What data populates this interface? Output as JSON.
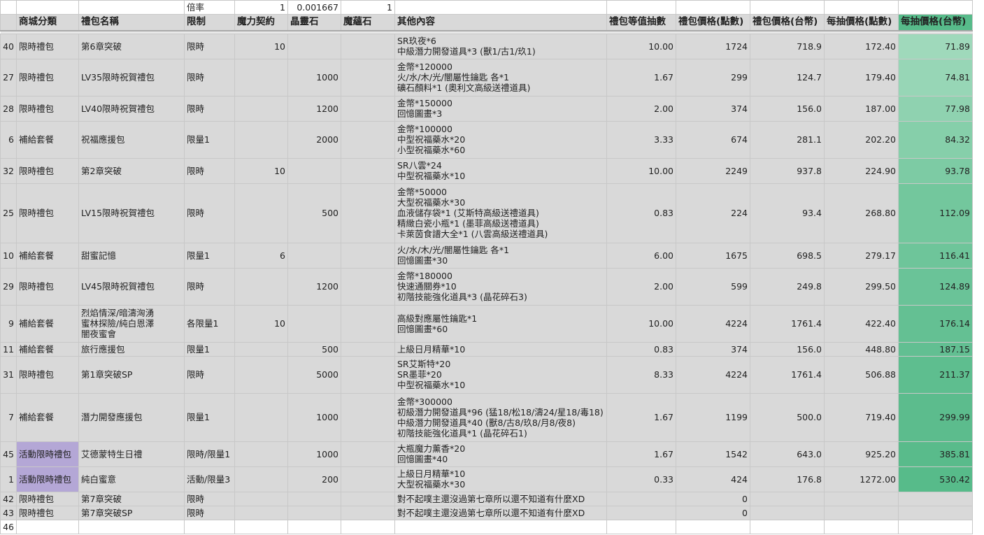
{
  "top_row": {
    "label": "倍率",
    "v1": "1",
    "v2": "0.001667",
    "v3": "1"
  },
  "headers": [
    "商城分類",
    "禮包名稱",
    "限制",
    "魔力契約",
    "晶靈石",
    "魔蘊石",
    "其他內容",
    "禮包等值抽數",
    "禮包價格(點數)",
    "禮包價格(台幣)",
    "每抽價格(點數)",
    "每抽價格(台幣)"
  ],
  "colors": {
    "header_gray": "#d9d9d9",
    "purple": "#b4a7d6",
    "green_scale": [
      "#9fd9bb",
      "#97d6b6",
      "#8fd2b0",
      "#86cfaa",
      "#7dcba4",
      "#73c79d",
      "#6ec59a",
      "#6ac398",
      "#64c093",
      "#62bf92",
      "#5ebe8f",
      "#5cbc8d",
      "#59bb8b",
      "#57bb8a"
    ]
  },
  "rows": [
    {
      "id": "40",
      "cat": "限時禮包",
      "name": [
        "第6章突破"
      ],
      "limit": "限時",
      "mana": "10",
      "crystal": "",
      "stone": "",
      "content": [
        "SR玖夜*6",
        "中級潛力開發道具*3 (獸1/古1/玖1)"
      ],
      "draws": "10.00",
      "pts": "1724",
      "twd": "718.9",
      "ppd": "172.40",
      "tpd": "71.89"
    },
    {
      "id": "27",
      "cat": "限時禮包",
      "name": [
        "LV35限時祝賀禮包"
      ],
      "limit": "限時",
      "mana": "",
      "crystal": "1000",
      "stone": "",
      "content": [
        "金幣*120000",
        "火/水/木/光/闇屬性鑰匙 各*1",
        "礦石顏料*1 (奧利文高級送禮道具)"
      ],
      "draws": "1.67",
      "pts": "299",
      "twd": "124.7",
      "ppd": "179.40",
      "tpd": "74.81"
    },
    {
      "id": "28",
      "cat": "限時禮包",
      "name": [
        "LV40限時祝賀禮包"
      ],
      "limit": "限時",
      "mana": "",
      "crystal": "1200",
      "stone": "",
      "content": [
        "金幣*150000",
        "回憶圖畫*3"
      ],
      "draws": "2.00",
      "pts": "374",
      "twd": "156.0",
      "ppd": "187.00",
      "tpd": "77.98"
    },
    {
      "id": "6",
      "cat": "補給套餐",
      "name": [
        "祝福應援包"
      ],
      "limit": "限量1",
      "mana": "",
      "crystal": "2000",
      "stone": "",
      "content": [
        "金幣*100000",
        "中型祝福藥水*20",
        "小型祝福藥水*60"
      ],
      "draws": "3.33",
      "pts": "674",
      "twd": "281.1",
      "ppd": "202.20",
      "tpd": "84.32"
    },
    {
      "id": "32",
      "cat": "限時禮包",
      "name": [
        "第2章突破"
      ],
      "limit": "限時",
      "mana": "10",
      "crystal": "",
      "stone": "",
      "content": [
        "SR八雲*24",
        "中型祝福藥水*10"
      ],
      "draws": "10.00",
      "pts": "2249",
      "twd": "937.8",
      "ppd": "224.90",
      "tpd": "93.78"
    },
    {
      "id": "25",
      "cat": "限時禮包",
      "name": [
        "LV15限時祝賀禮包"
      ],
      "limit": "限時",
      "mana": "",
      "crystal": "500",
      "stone": "",
      "content": [
        "金幣*50000",
        "大型祝福藥水*30",
        "血液儲存袋*1 (艾斯特高級送禮道具)",
        "精緻白瓷小瓶*1 (墨菲高級送禮道具)",
        "卡萊茵食譜大全*1 (八雲高級送禮道具)"
      ],
      "draws": "0.83",
      "pts": "224",
      "twd": "93.4",
      "ppd": "268.80",
      "tpd": "112.09"
    },
    {
      "id": "10",
      "cat": "補給套餐",
      "name": [
        "甜蜜記憶"
      ],
      "limit": "限量1",
      "mana": "6",
      "crystal": "",
      "stone": "",
      "content": [
        "火/水/木/光/闇屬性鑰匙 各*1",
        "回憶圖畫*30"
      ],
      "draws": "6.00",
      "pts": "1675",
      "twd": "698.5",
      "ppd": "279.17",
      "tpd": "116.41"
    },
    {
      "id": "29",
      "cat": "限時禮包",
      "name": [
        "LV45限時祝賀禮包"
      ],
      "limit": "限時",
      "mana": "",
      "crystal": "1200",
      "stone": "",
      "content": [
        "金幣*180000",
        "快速通關券*10",
        "初階技能強化道具*3 (晶花碎石3)"
      ],
      "draws": "2.00",
      "pts": "599",
      "twd": "249.8",
      "ppd": "299.50",
      "tpd": "124.89"
    },
    {
      "id": "9",
      "cat": "補給套餐",
      "name": [
        "烈焰情深/暗濤洶湧",
        "蜜林探險/純白恩澤",
        "闇夜蜜會"
      ],
      "limit": "各限量1",
      "mana": "10",
      "crystal": "",
      "stone": "",
      "content": [
        "高級對應屬性鑰匙*1",
        "回憶圖畫*60"
      ],
      "draws": "10.00",
      "pts": "4224",
      "twd": "1761.4",
      "ppd": "422.40",
      "tpd": "176.14"
    },
    {
      "id": "11",
      "cat": "補給套餐",
      "name": [
        "旅行應援包"
      ],
      "limit": "限量1",
      "mana": "",
      "crystal": "500",
      "stone": "",
      "content": [
        "上級日月精華*10"
      ],
      "draws": "0.83",
      "pts": "374",
      "twd": "156.0",
      "ppd": "448.80",
      "tpd": "187.15"
    },
    {
      "id": "31",
      "cat": "限時禮包",
      "name": [
        "第1章突破SP"
      ],
      "limit": "限時",
      "mana": "",
      "crystal": "5000",
      "stone": "",
      "content": [
        "SR艾斯特*20",
        "SR墨菲*20",
        "中型祝福藥水*10"
      ],
      "draws": "8.33",
      "pts": "4224",
      "twd": "1761.4",
      "ppd": "506.88",
      "tpd": "211.37"
    },
    {
      "id": "7",
      "cat": "補給套餐",
      "name": [
        "潛力開發應援包"
      ],
      "limit": "限量1",
      "mana": "",
      "crystal": "1000",
      "stone": "",
      "content": [
        "金幣*300000",
        "初級潛力開發道具*96 (猛18/松18/濤24/星18/毒18)",
        "中級潛力開發道具*40 (獸8/古8/玖8/月8/夜8)",
        "初階技能強化道具*1 (晶花碎石1)"
      ],
      "draws": "1.67",
      "pts": "1199",
      "twd": "500.0",
      "ppd": "719.40",
      "tpd": "299.99"
    },
    {
      "id": "45",
      "cat": "活動限時禮包",
      "name": [
        "艾德蒙特生日禮"
      ],
      "limit": "限時/限量1",
      "mana": "",
      "crystal": "1000",
      "stone": "",
      "content": [
        "大瓶魔力薰香*20",
        "回憶圖畫*40"
      ],
      "draws": "1.67",
      "pts": "1542",
      "twd": "643.0",
      "ppd": "925.20",
      "tpd": "385.81"
    },
    {
      "id": "1",
      "cat": "活動限時禮包",
      "name": [
        "純白蜜意"
      ],
      "limit": "活動/限量3",
      "mana": "",
      "crystal": "200",
      "stone": "",
      "content": [
        "上級日月精華*10",
        "大型祝福藥水*30"
      ],
      "draws": "0.33",
      "pts": "424",
      "twd": "176.8",
      "ppd": "1272.00",
      "tpd": "530.42"
    },
    {
      "id": "42",
      "cat": "限時禮包",
      "name": [
        "第7章突破"
      ],
      "limit": "限時",
      "mana": "",
      "crystal": "",
      "stone": "",
      "content": [
        "對不起噗主還沒過第七章所以還不知道有什麼XD"
      ],
      "draws": "",
      "pts": "0",
      "twd": "",
      "ppd": "",
      "tpd": ""
    },
    {
      "id": "43",
      "cat": "限時禮包",
      "name": [
        "第7章突破SP"
      ],
      "limit": "限時",
      "mana": "",
      "crystal": "",
      "stone": "",
      "content": [
        "對不起噗主還沒過第七章所以還不知道有什麼XD"
      ],
      "draws": "",
      "pts": "0",
      "twd": "",
      "ppd": "",
      "tpd": ""
    },
    {
      "id": "46",
      "cat": "",
      "name": [
        ""
      ],
      "limit": "",
      "mana": "",
      "crystal": "",
      "stone": "",
      "content": [
        ""
      ],
      "draws": "",
      "pts": "",
      "twd": "",
      "ppd": "",
      "tpd": ""
    }
  ]
}
